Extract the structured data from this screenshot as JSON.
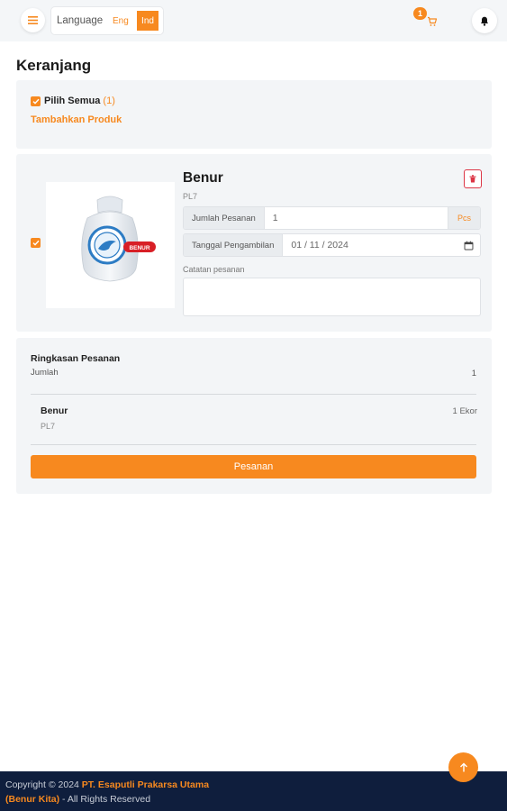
{
  "header": {
    "language_label": "Language",
    "lang_options": [
      "Eng",
      "Ind"
    ],
    "selected_lang": "Ind",
    "cart_count": "1",
    "accent_color": "#f7891f"
  },
  "page": {
    "title": "Keranjang"
  },
  "select_card": {
    "select_all_label": "Pilih Semua",
    "select_all_count": "(1)",
    "add_product_label": "Tambahkan Produk"
  },
  "product": {
    "name": "Benur",
    "code": "PL7",
    "image_label": "BENUR",
    "qty_label": "Jumlah Pesanan",
    "qty_value": "1",
    "qty_unit": "Pcs",
    "date_label": "Tanggal Pengambilan",
    "date_value": "01 / 11 / 2024",
    "notes_label": "Catatan pesanan",
    "notes_value": ""
  },
  "summary": {
    "title": "Ringkasan Pesanan",
    "qty_label": "Jumlah",
    "qty_value": "1",
    "item_name": "Benur",
    "item_code": "PL7",
    "item_qty": "1 Ekor",
    "order_button": "Pesanan"
  },
  "footer": {
    "copyright_prefix": "Copyright © 2024",
    "company": "PT. Esaputli Prakarsa Utama",
    "brand": "(Benur Kita)",
    "suffix": "- All Rights Reserved"
  }
}
